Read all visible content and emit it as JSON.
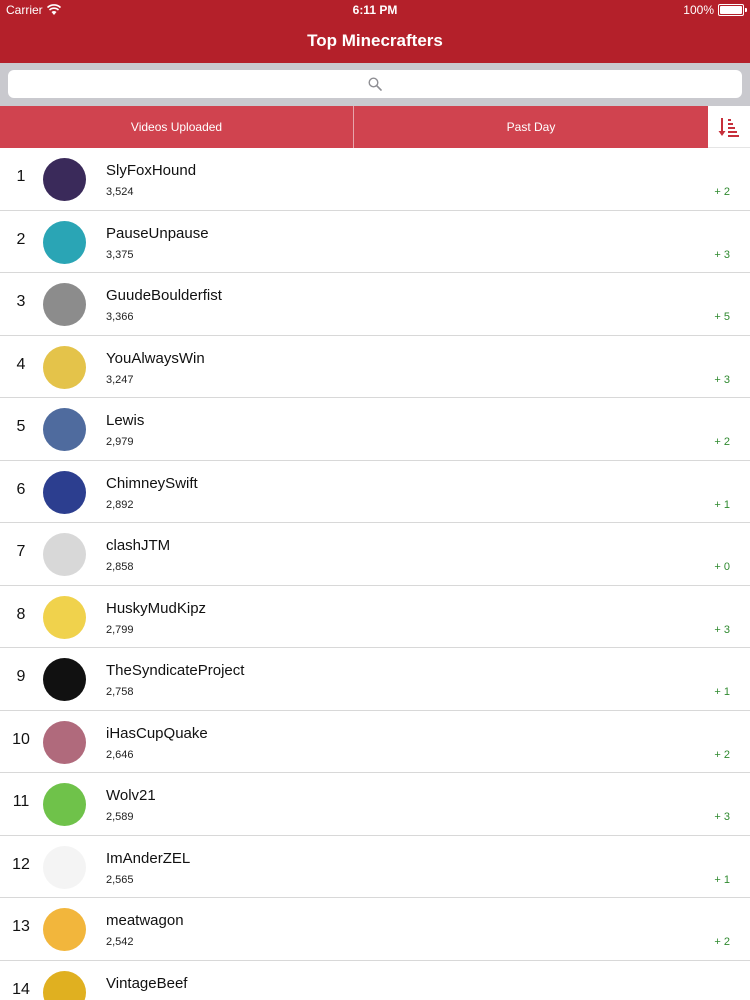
{
  "status_bar": {
    "carrier": "Carrier",
    "time": "6:11 PM",
    "battery": "100%"
  },
  "nav": {
    "title": "Top Minecrafters"
  },
  "search": {
    "placeholder": ""
  },
  "segments": {
    "videos": "Videos Uploaded",
    "period": "Past Day"
  },
  "colors": {
    "header": "#b4202a",
    "segment_bar": "#d0434f",
    "positive": "#2f8a2f",
    "search_area": "#c9c9ce"
  },
  "rows": [
    {
      "rank": "1",
      "name": "SlyFoxHound",
      "count": "3,524",
      "change": "+ 2",
      "avatar_color": "#3a2a5a",
      "avatar_icon": "fox-avatar-icon"
    },
    {
      "rank": "2",
      "name": "PauseUnpause",
      "count": "3,375",
      "change": "+ 3",
      "avatar_color": "#2aa5b5",
      "avatar_icon": "blocky-avatar-icon"
    },
    {
      "rank": "3",
      "name": "GuudeBoulderfist",
      "count": "3,366",
      "change": "+ 5",
      "avatar_color": "#8c8c8c",
      "avatar_icon": "letter-g-avatar-icon"
    },
    {
      "rank": "4",
      "name": "YouAlwaysWin",
      "count": "3,247",
      "change": "+ 3",
      "avatar_color": "#e4c34a",
      "avatar_icon": "yaw-logo-avatar-icon"
    },
    {
      "rank": "5",
      "name": "Lewis",
      "count": "2,979",
      "change": "+ 2",
      "avatar_color": "#4f6b9e",
      "avatar_icon": "bearded-avatar-icon"
    },
    {
      "rank": "6",
      "name": "ChimneySwift",
      "count": "2,892",
      "change": "+ 1",
      "avatar_color": "#2c3e8f",
      "avatar_icon": "cs-logo-avatar-icon"
    },
    {
      "rank": "7",
      "name": "clashJTM",
      "count": "2,858",
      "change": "+ 0",
      "avatar_color": "#d8d8d8",
      "avatar_icon": "goggles-avatar-icon"
    },
    {
      "rank": "8",
      "name": "HuskyMudKipz",
      "count": "2,799",
      "change": "+ 3",
      "avatar_color": "#f0d24c",
      "avatar_icon": "purple-hat-avatar-icon"
    },
    {
      "rank": "9",
      "name": "TheSyndicateProject",
      "count": "2,758",
      "change": "+ 1",
      "avatar_color": "#111111",
      "avatar_icon": "syndicate-logo-avatar-icon"
    },
    {
      "rank": "10",
      "name": "iHasCupQuake",
      "count": "2,646",
      "change": "+ 2",
      "avatar_color": "#b06a7c",
      "avatar_icon": "portrait-avatar-icon"
    },
    {
      "rank": "11",
      "name": "Wolv21",
      "count": "2,589",
      "change": "+ 3",
      "avatar_color": "#6fc24a",
      "avatar_icon": "cap-avatar-icon"
    },
    {
      "rank": "12",
      "name": "ImAnderZEL",
      "count": "2,565",
      "change": "+ 1",
      "avatar_color": "#f4f4f4",
      "avatar_icon": "sketch-face-avatar-icon"
    },
    {
      "rank": "13",
      "name": "meatwagon",
      "count": "2,542",
      "change": "+ 2",
      "avatar_color": "#f2b63c",
      "avatar_icon": "sunglasses-avatar-icon"
    },
    {
      "rank": "14",
      "name": "VintageBeef",
      "count": "",
      "change": "",
      "avatar_color": "#e0b020",
      "avatar_icon": "beef-avatar-icon"
    }
  ]
}
